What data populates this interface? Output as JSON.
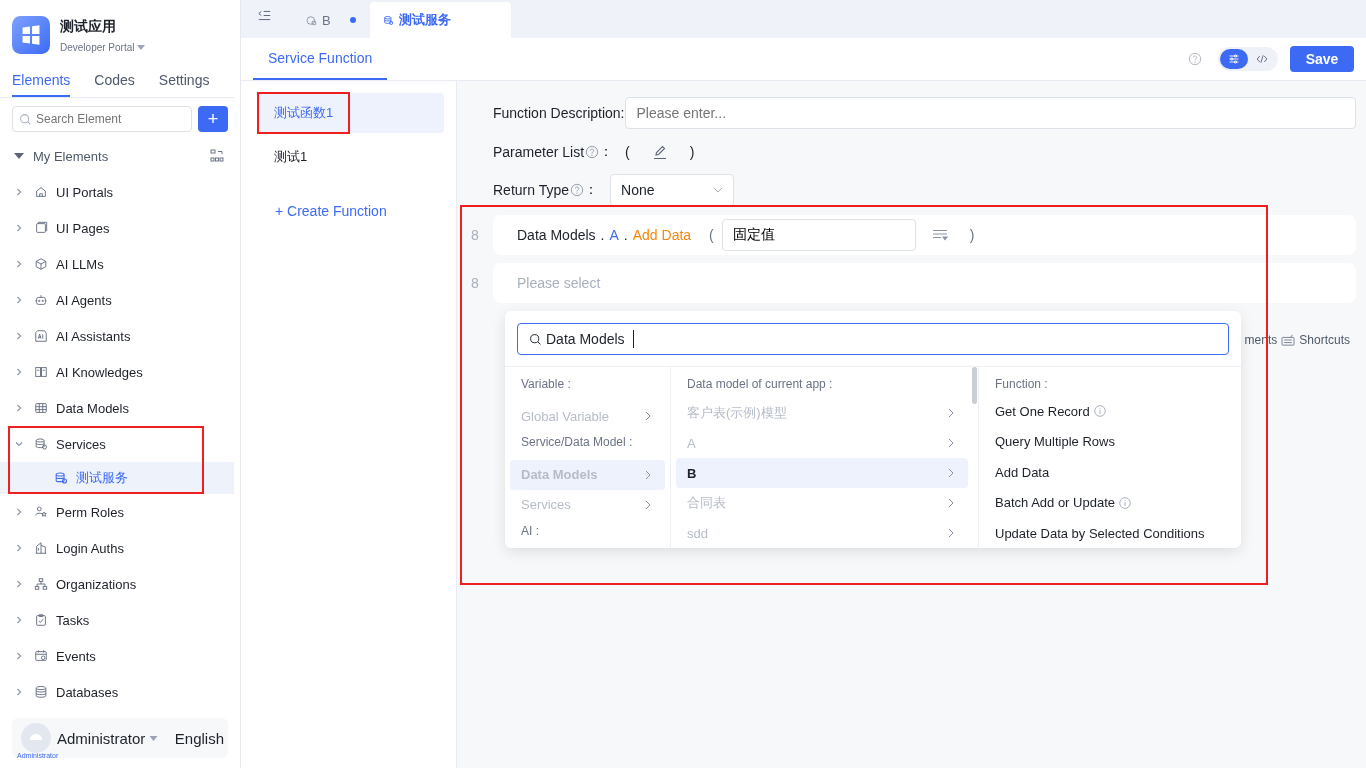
{
  "app": {
    "name": "测试应用",
    "portal": "Developer Portal"
  },
  "sidebar_tabs": [
    {
      "label": "Elements",
      "selected": true
    },
    {
      "label": "Codes",
      "selected": false
    },
    {
      "label": "Settings",
      "selected": false
    }
  ],
  "search": {
    "placeholder": "Search Element"
  },
  "add_button": "+",
  "tree": {
    "label": "My Elements",
    "expanded": true,
    "children": [
      {
        "label": "UI Portals",
        "kind": "home",
        "expanded": false,
        "highlighted": false
      },
      {
        "label": "UI Pages",
        "kind": "page",
        "expanded": false,
        "highlighted": false
      },
      {
        "label": "AI LLMs",
        "kind": "cube",
        "expanded": false,
        "highlighted": false
      },
      {
        "label": "AI Agents",
        "kind": "robot",
        "expanded": false,
        "highlighted": false
      },
      {
        "label": "AI Assistants",
        "kind": "ai",
        "expanded": false,
        "highlighted": false
      },
      {
        "label": "AI Knowledges",
        "kind": "book",
        "expanded": false,
        "highlighted": false
      },
      {
        "label": "Data Models",
        "kind": "table",
        "expanded": false,
        "highlighted": false
      },
      {
        "label": "Services",
        "kind": "service",
        "expanded": true,
        "highlighted": true,
        "children": [
          {
            "label": "测试服务",
            "kind": "service",
            "selected": true
          }
        ]
      },
      {
        "label": "Perm Roles",
        "kind": "people",
        "expanded": false,
        "highlighted": false
      },
      {
        "label": "Login Auths",
        "kind": "building",
        "expanded": false,
        "highlighted": false
      },
      {
        "label": "Organizations",
        "kind": "org",
        "expanded": false,
        "highlighted": false
      },
      {
        "label": "Tasks",
        "kind": "task",
        "expanded": false,
        "highlighted": false
      },
      {
        "label": "Events",
        "kind": "calendar",
        "expanded": false,
        "highlighted": false
      },
      {
        "label": "Databases",
        "kind": "db",
        "expanded": false,
        "highlighted": false
      }
    ]
  },
  "user": {
    "name": "Administrator",
    "avatar_label": "Administrator",
    "language": "English"
  },
  "editor_tabs": [
    {
      "label": "B",
      "kind": "model",
      "modified": true,
      "selected": false
    },
    {
      "label": "测试服务",
      "kind": "service",
      "modified": false,
      "selected": true
    }
  ],
  "header": {
    "tab": "Service Function",
    "modes": [
      {
        "kind": "visual",
        "selected": true
      },
      {
        "kind": "code",
        "selected": false
      }
    ],
    "save": "Save"
  },
  "functions": [
    {
      "label": "测试函数1",
      "selected": true,
      "highlighted": true
    },
    {
      "label": "测试1",
      "selected": false,
      "highlighted": false
    }
  ],
  "create_function": "+ Create Function",
  "form": {
    "description": {
      "label": "Function Description:",
      "placeholder": "Please enter..."
    },
    "parameters": {
      "label": "Parameter List",
      "suffix": "：",
      "open": "(",
      "close": ")"
    },
    "return_type": {
      "label": "Return Type",
      "suffix": "：",
      "value": "None"
    }
  },
  "code": {
    "highlighted": true,
    "statements": [
      {
        "kind": "call",
        "line": "8",
        "path": [
          {
            "kind": "object",
            "text": "Data Models"
          },
          {
            "kind": "sep",
            "text": "."
          },
          {
            "kind": "model",
            "text": "A"
          },
          {
            "kind": "sep",
            "text": "."
          },
          {
            "kind": "method",
            "text": "Add Data"
          }
        ],
        "open": "(",
        "argument": "固定值",
        "close": ")"
      },
      {
        "kind": "empty",
        "line": "8",
        "placeholder": "Please select"
      }
    ]
  },
  "shortcuts": {
    "hidden_text": "ments",
    "label": "Shortcuts"
  },
  "picker": {
    "search_value": "Data Models",
    "columns": [
      {
        "items": [
          {
            "kind": "heading",
            "label": "Variable :"
          },
          {
            "kind": "option",
            "label": "Global Variable",
            "selected": false,
            "disabled": true
          },
          {
            "kind": "heading",
            "label": "Service/Data Model :"
          },
          {
            "kind": "option",
            "label": "Data Models",
            "selected": true,
            "disabled": true
          },
          {
            "kind": "option",
            "label": "Services",
            "selected": false,
            "disabled": true
          },
          {
            "kind": "heading",
            "label": "AI :"
          }
        ]
      },
      {
        "items": [
          {
            "kind": "heading",
            "label": "Data model of current app :"
          },
          {
            "kind": "option",
            "label": "客户表(示例)模型",
            "selected": false,
            "disabled": true
          },
          {
            "kind": "option",
            "label": "A",
            "selected": false,
            "disabled": true
          },
          {
            "kind": "option",
            "label": "B",
            "selected": true,
            "disabled": false
          },
          {
            "kind": "option",
            "label": "合同表",
            "selected": false,
            "disabled": true
          },
          {
            "kind": "option",
            "label": "sdd",
            "selected": false,
            "disabled": true
          }
        ]
      },
      {
        "items": [
          {
            "kind": "heading",
            "label": "Function :"
          },
          {
            "kind": "leaf",
            "label": "Get One Record",
            "info": true
          },
          {
            "kind": "leaf",
            "label": "Query Multiple Rows",
            "info": false
          },
          {
            "kind": "leaf",
            "label": "Add Data",
            "info": false
          },
          {
            "kind": "leaf",
            "label": "Batch Add or Update",
            "info": true
          },
          {
            "kind": "leaf",
            "label": "Update Data by Selected Conditions",
            "info": false
          }
        ]
      }
    ]
  }
}
